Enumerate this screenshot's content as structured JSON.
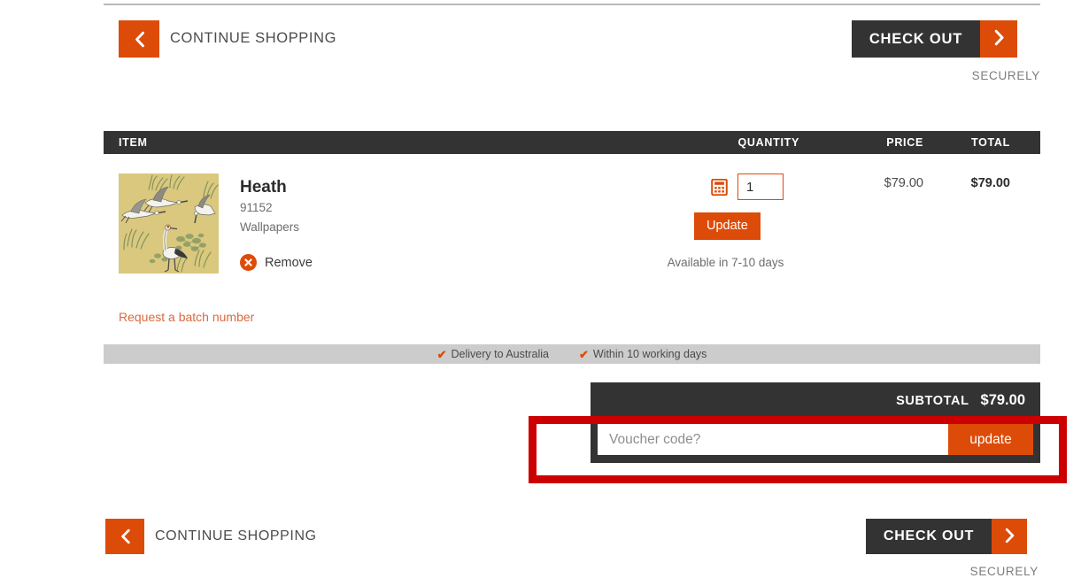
{
  "colors": {
    "accent_orange": "#dd4b08",
    "dark_bar": "#333333",
    "annotation_red": "#cc0000",
    "strip_gray": "#cccccc",
    "thumb_background": "#d9c87e"
  },
  "top_bar": {
    "continue_label": "CONTINUE SHOPPING",
    "back_icon": "chevron-left-icon",
    "checkout_label": "CHECK OUT",
    "checkout_arrow_icon": "chevron-right-icon",
    "securely_label": "SECURELY"
  },
  "cart": {
    "headers": {
      "item": "ITEM",
      "quantity": "QUANTITY",
      "price": "PRICE",
      "total": "TOTAL"
    },
    "rows": [
      {
        "name": "Heath",
        "sku": "91152",
        "category": "Wallpapers",
        "remove_label": "Remove",
        "remove_icon": "circle-x-icon",
        "calculator_icon": "calculator-icon",
        "quantity": "1",
        "update_label": "Update",
        "availability": "Available in 7-10 days",
        "price": "$79.00",
        "total": "$79.00",
        "thumbnail_alt": "Heath wallpaper with cranes on khaki background"
      }
    ],
    "batch_link": "Request a batch number"
  },
  "delivery_strip": {
    "items": [
      {
        "tick": "✔",
        "label": "Delivery to Australia"
      },
      {
        "tick": "✔",
        "label": "Within 10 working days"
      }
    ]
  },
  "totals": {
    "subtotal_label": "SUBTOTAL",
    "subtotal_value": "$79.00",
    "voucher_value": "",
    "voucher_placeholder": "Voucher code?",
    "voucher_update_label": "update"
  },
  "bottom_bar": {
    "continue_label": "CONTINUE SHOPPING",
    "back_icon": "chevron-left-icon",
    "checkout_label": "CHECK OUT",
    "checkout_arrow_icon": "chevron-right-icon",
    "securely_label": "SECURELY"
  }
}
